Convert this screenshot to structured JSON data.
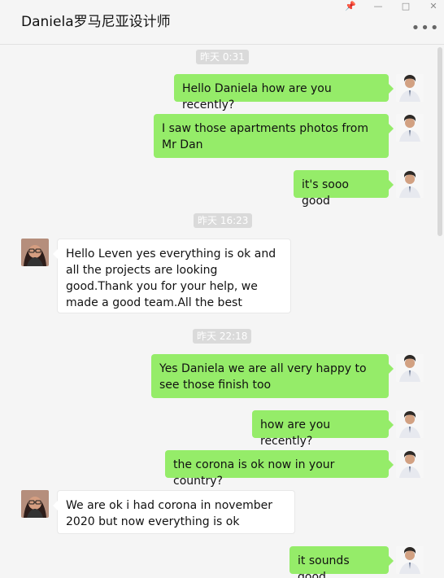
{
  "app": {
    "title": "Daniela罗马尼亚设计师"
  },
  "window_controls": {
    "pin": "📌",
    "minimize": "—",
    "maximize": "□",
    "close": "✕",
    "more": "•••"
  },
  "timestamps": [
    "昨天 0:31",
    "昨天 16:23",
    "昨天 22:18"
  ],
  "messages": [
    {
      "side": "right",
      "sender": "self",
      "text": "Hello Daniela how are you recently?"
    },
    {
      "side": "right",
      "sender": "self",
      "text": "I saw those apartments photos from Mr Dan"
    },
    {
      "side": "right",
      "sender": "self",
      "text": "it's sooo good"
    },
    {
      "side": "left",
      "sender": "other",
      "text": "Hello Leven yes everything is ok and all the projects are looking good.Thank you for  your help, we made a good team.All the best"
    },
    {
      "side": "right",
      "sender": "self",
      "text": "Yes Daniela we are all very happy to see those finish too"
    },
    {
      "side": "right",
      "sender": "self",
      "text": "how are you recently?"
    },
    {
      "side": "right",
      "sender": "self",
      "text": "the corona is ok now in your country?"
    },
    {
      "side": "left",
      "sender": "other",
      "text": "We are ok i had corona in november 2020 but now everything is ok"
    },
    {
      "side": "right",
      "sender": "self",
      "text": "it sounds good"
    }
  ],
  "colors": {
    "window_background": "#f5f5f5",
    "outgoing_bubble": "#95ec69",
    "incoming_bubble": "#ffffff",
    "timestamp_background": "#dadada",
    "timestamp_text": "#ffffff"
  },
  "icons": {
    "self_avatar": "man-in-white-shirt-avatar",
    "other_avatar": "woman-with-glasses-avatar"
  }
}
